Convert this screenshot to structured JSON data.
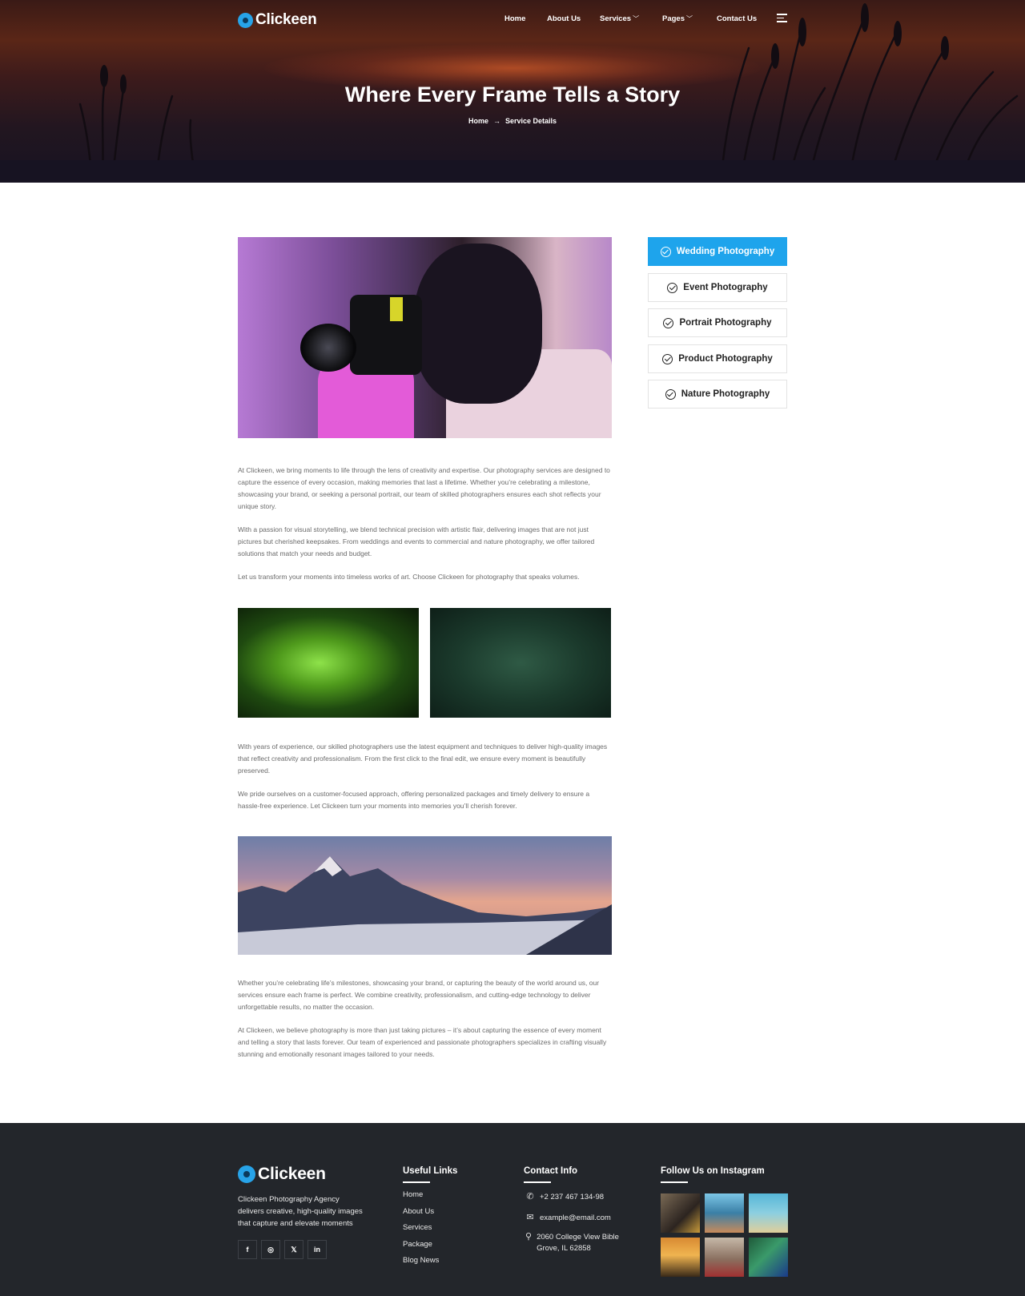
{
  "header": {
    "logo_text": "Clickeen",
    "nav": [
      {
        "label": "Home"
      },
      {
        "label": "About Us"
      },
      {
        "label": "Services"
      },
      {
        "label": "Pages"
      },
      {
        "label": "Contact Us"
      }
    ],
    "title": "Where Every Frame Tells a Story",
    "breadcrumb": {
      "home": "Home",
      "current": "Service Details"
    }
  },
  "content": {
    "paragraphs_top": [
      "At Clickeen, we bring moments to life through the lens of creativity and expertise. Our photography services are designed to capture the essence of every occasion, making memories that last a lifetime. Whether you’re celebrating a milestone, showcasing your brand, or seeking a personal portrait, our team of skilled photographers ensures each shot reflects your unique story.",
      "With a passion for visual storytelling, we blend technical precision with artistic flair, delivering images that are not just pictures but cherished keepsakes. From weddings and events to commercial and nature photography, we offer tailored solutions that match your needs and budget.",
      "Let us transform your moments into timeless works of art. Choose Clickeen for photography that speaks volumes."
    ],
    "paragraphs_middle": [
      "With years of experience, our skilled photographers use the latest equipment and techniques to deliver high-quality images that reflect creativity and professionalism. From the first click to the final edit, we ensure every moment is beautifully preserved.",
      "We pride ourselves on a customer-focused approach, offering personalized packages and timely delivery to ensure a hassle-free experience. Let Clickeen turn your moments into memories you’ll cherish forever."
    ],
    "paragraphs_bottom": [
      "Whether you’re celebrating life’s milestones, showcasing your brand, or capturing the beauty of the world around us, our services ensure each frame is perfect. We combine creativity, professionalism, and cutting-edge technology to deliver unforgettable results, no matter the occasion.",
      "At Clickeen, we believe photography is more than just taking pictures – it’s about capturing the essence of every moment and telling a story that lasts forever. Our team of experienced and passionate photographers specializes in crafting visually stunning and emotionally resonant images tailored to your needs."
    ]
  },
  "sidebar": {
    "services": [
      {
        "label": "Wedding Photography",
        "active": true
      },
      {
        "label": "Event Photography",
        "active": false
      },
      {
        "label": "Portrait Photography",
        "active": false
      },
      {
        "label": "Product Photography",
        "active": false
      },
      {
        "label": "Nature Photography",
        "active": false
      }
    ]
  },
  "footer": {
    "logo_text": "Clickeen",
    "description": "Clickeen Photography Agency delivers creative, high-quality images that capture and elevate moments",
    "socials": [
      {
        "icon": "facebook-icon",
        "glyph": "f"
      },
      {
        "icon": "instagram-icon",
        "glyph": "◎"
      },
      {
        "icon": "x-icon",
        "glyph": "𝕏"
      },
      {
        "icon": "linkedin-icon",
        "glyph": "in"
      }
    ],
    "useful_links_title": "Useful Links",
    "useful_links": [
      "Home",
      "About Us",
      "Services",
      "Package",
      "Blog News"
    ],
    "contact_title": "Contact Info",
    "contact": {
      "phone": "+2 237 467 134-98",
      "email": "example@email.com",
      "address": "2060 College View Bible Grove, IL 62858"
    },
    "instagram_title": "Follow Us on Instagram"
  },
  "colors": {
    "accent": "#1ea4ec",
    "footer_bg": "#23262b"
  }
}
